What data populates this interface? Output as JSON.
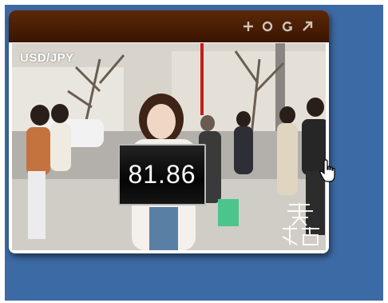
{
  "window": {
    "controls": [
      {
        "name": "add-icon"
      },
      {
        "name": "circle-icon"
      },
      {
        "name": "refresh-icon"
      },
      {
        "name": "expand-arrow-icon"
      }
    ]
  },
  "widget": {
    "currency_pair": "USD/JPY",
    "rate": "81.86"
  },
  "colors": {
    "background": "#3c6aa4",
    "titlebar": "#4a1f06",
    "control_icons": "#cfc3b8",
    "rate_text": "#ffffff"
  }
}
